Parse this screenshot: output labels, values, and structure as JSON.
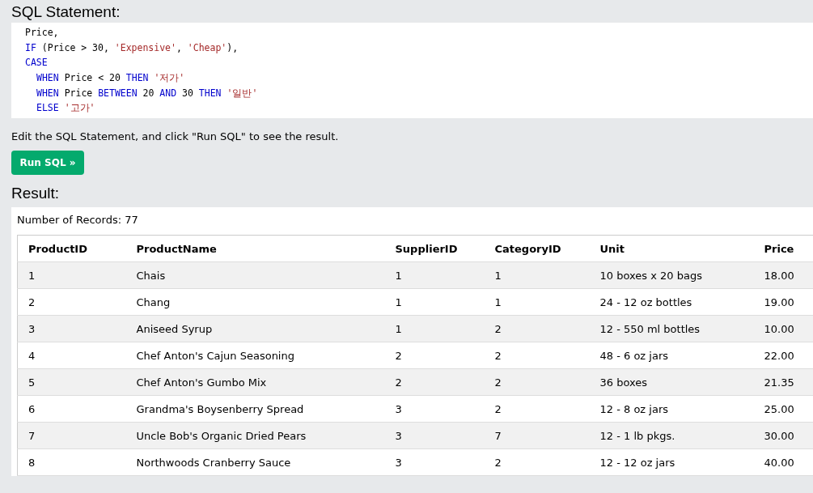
{
  "sql_heading": "SQL Statement:",
  "code_lines": [
    {
      "tokens": [
        {
          "kind": "plain",
          "text": "Price,"
        }
      ]
    },
    {
      "tokens": [
        {
          "kind": "keyword",
          "text": "IF"
        },
        {
          "kind": "plain",
          "text": " (Price > 30, "
        },
        {
          "kind": "string",
          "text": "'Expensive'"
        },
        {
          "kind": "plain",
          "text": ", "
        },
        {
          "kind": "string",
          "text": "'Cheap'"
        },
        {
          "kind": "plain",
          "text": "),"
        }
      ]
    },
    {
      "tokens": [
        {
          "kind": "keyword",
          "text": "CASE"
        }
      ],
      "children": [
        {
          "tokens": [
            {
              "kind": "keyword",
              "text": "WHEN"
            },
            {
              "kind": "plain",
              "text": " Price < 20 "
            },
            {
              "kind": "keyword",
              "text": "THEN "
            },
            {
              "kind": "string",
              "text": "'저가'"
            }
          ]
        },
        {
          "tokens": [
            {
              "kind": "keyword",
              "text": "WHEN"
            },
            {
              "kind": "plain",
              "text": " Price "
            },
            {
              "kind": "keyword",
              "text": "BETWEEN"
            },
            {
              "kind": "plain",
              "text": " 20 "
            },
            {
              "kind": "keyword",
              "text": "AND"
            },
            {
              "kind": "plain",
              "text": " 30 "
            },
            {
              "kind": "keyword",
              "text": "THEN "
            },
            {
              "kind": "string",
              "text": "'일반'"
            }
          ]
        },
        {
          "tokens": [
            {
              "kind": "keyword",
              "text": "ELSE "
            },
            {
              "kind": "string",
              "text": "'고가'"
            }
          ]
        }
      ]
    }
  ],
  "instruction": "Edit the SQL Statement, and click \"Run SQL\" to see the result.",
  "run_button": "Run SQL »",
  "result_heading": "Result:",
  "record_count": "Number of Records: 77",
  "table": {
    "columns": [
      "ProductID",
      "ProductName",
      "SupplierID",
      "CategoryID",
      "Unit",
      "Price"
    ],
    "rows": [
      [
        "1",
        "Chais",
        "1",
        "1",
        "10 boxes x 20 bags",
        "18.00"
      ],
      [
        "2",
        "Chang",
        "1",
        "1",
        "24 - 12 oz bottles",
        "19.00"
      ],
      [
        "3",
        "Aniseed Syrup",
        "1",
        "2",
        "12 - 550 ml bottles",
        "10.00"
      ],
      [
        "4",
        "Chef Anton's Cajun Seasoning",
        "2",
        "2",
        "48 - 6 oz jars",
        "22.00"
      ],
      [
        "5",
        "Chef Anton's Gumbo Mix",
        "2",
        "2",
        "36 boxes",
        "21.35"
      ],
      [
        "6",
        "Grandma's Boysenberry Spread",
        "3",
        "2",
        "12 - 8 oz jars",
        "25.00"
      ],
      [
        "7",
        "Uncle Bob's Organic Dried Pears",
        "3",
        "7",
        "12 - 1 lb pkgs.",
        "30.00"
      ],
      [
        "8",
        "Northwoods Cranberry Sauce",
        "3",
        "2",
        "12 - 12 oz jars",
        "40.00"
      ]
    ]
  }
}
